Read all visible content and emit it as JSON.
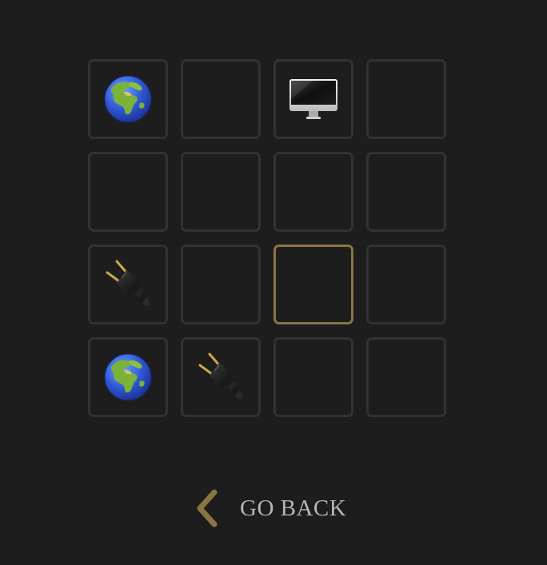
{
  "board": {
    "tiles": [
      {
        "icon": "globe-icon"
      },
      {
        "icon": ""
      },
      {
        "icon": "desktop-computer-icon"
      },
      {
        "icon": ""
      },
      {
        "icon": ""
      },
      {
        "icon": ""
      },
      {
        "icon": ""
      },
      {
        "icon": ""
      },
      {
        "icon": "electric-plug-icon"
      },
      {
        "icon": ""
      },
      {
        "icon": "",
        "selected": true
      },
      {
        "icon": ""
      },
      {
        "icon": "globe-icon"
      },
      {
        "icon": "electric-plug-icon"
      },
      {
        "icon": ""
      },
      {
        "icon": ""
      }
    ],
    "tile_border_color": "#323232",
    "selected_border_color": "#8a7443",
    "background_color": "#1d1d1d"
  },
  "navigation": {
    "back_label": "GO BACK",
    "back_icon": "chevron-left-icon",
    "accent_color": "#8a7443"
  }
}
